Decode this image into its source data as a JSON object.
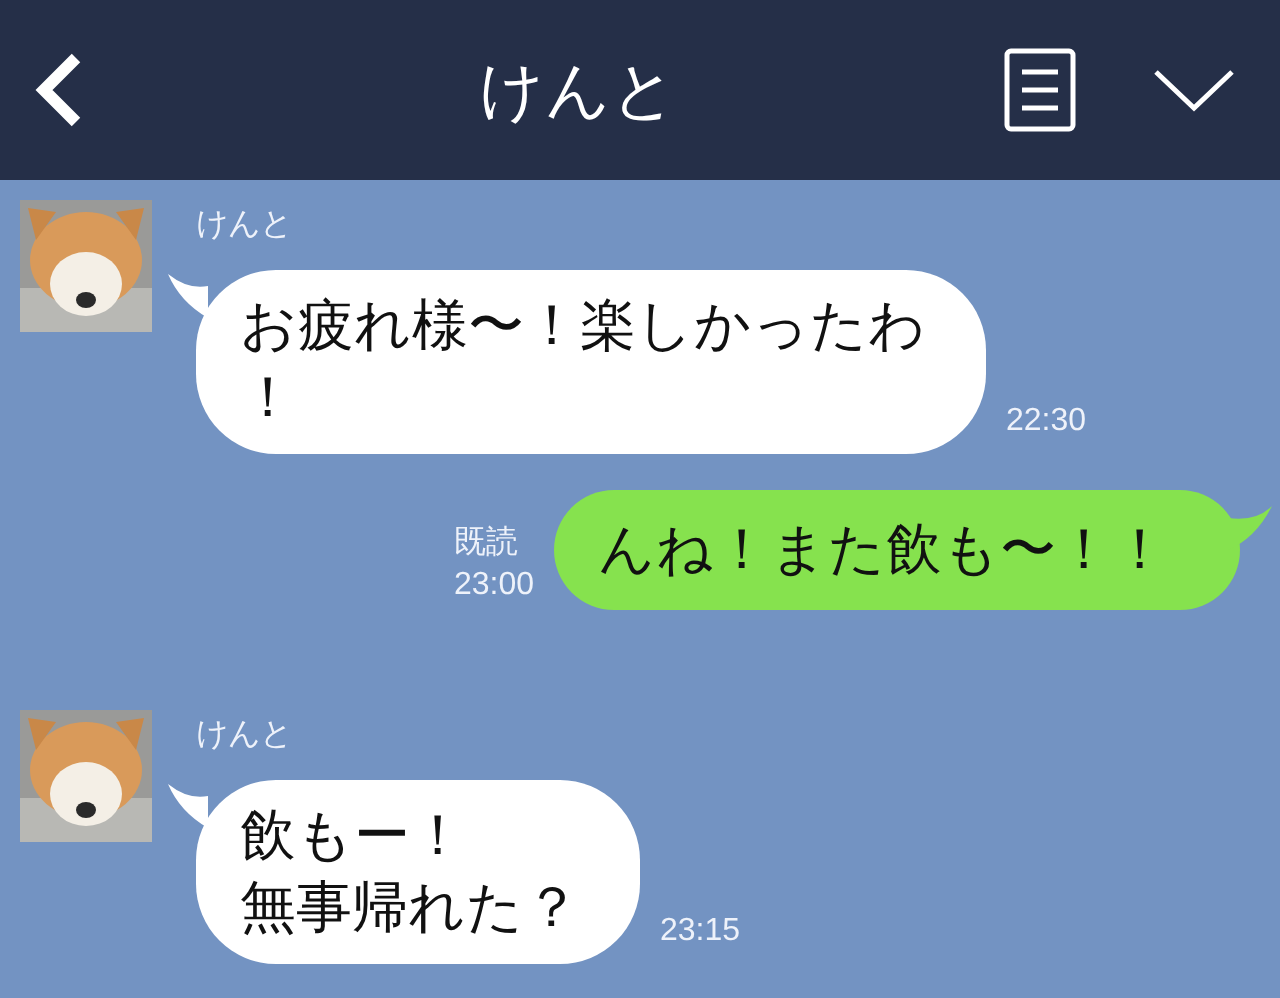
{
  "header": {
    "title": "けんと"
  },
  "messages": [
    {
      "kind": "received",
      "sender": "けんと",
      "lines": [
        "お疲れ様〜！楽しかったわ",
        "！"
      ],
      "time": "22:30"
    },
    {
      "kind": "sent",
      "lines": [
        "んね！また飲も〜！！"
      ],
      "read": "既読",
      "time": "23:00"
    },
    {
      "kind": "received",
      "sender": "けんと",
      "lines": [
        "飲もー！",
        "無事帰れた？"
      ],
      "time": "23:15"
    }
  ]
}
